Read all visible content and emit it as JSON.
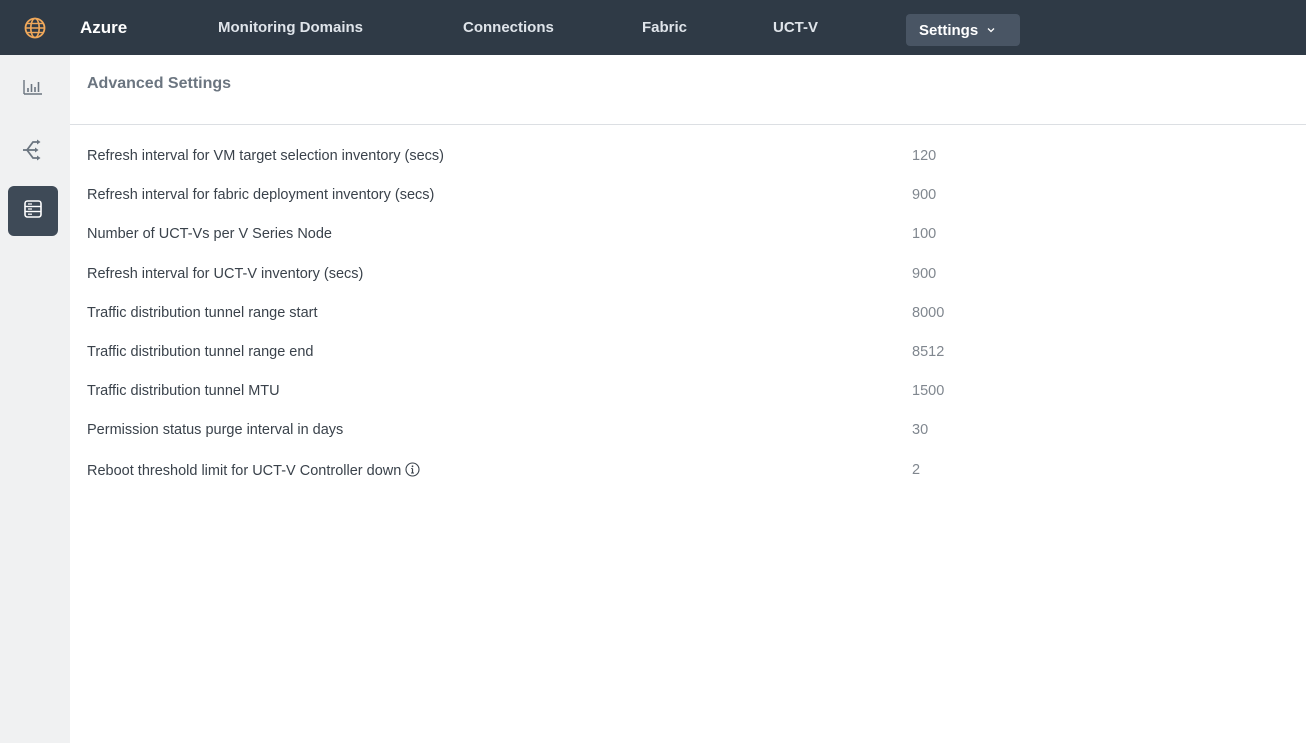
{
  "app": {
    "brand": "Azure",
    "brand_icon": "globe-icon"
  },
  "nav": {
    "items": [
      {
        "label": "Monitoring Domains"
      },
      {
        "label": "Connections"
      },
      {
        "label": "Fabric"
      },
      {
        "label": "UCT-V"
      }
    ],
    "settings_label": "Settings",
    "settings_icon": "chevron-down-icon"
  },
  "sidebar": {
    "items": [
      {
        "icon": "bar-chart-icon",
        "active": false
      },
      {
        "icon": "network-icon",
        "active": false
      },
      {
        "icon": "server-icon",
        "active": true
      }
    ]
  },
  "page": {
    "title": "Advanced Settings"
  },
  "settings": [
    {
      "label": "Refresh interval for VM target selection inventory (secs)",
      "value": "120"
    },
    {
      "label": "Refresh interval for fabric deployment inventory (secs)",
      "value": "900"
    },
    {
      "label": "Number of UCT-Vs per V Series Node",
      "value": "100"
    },
    {
      "label": "Refresh interval for UCT-V inventory (secs)",
      "value": "900"
    },
    {
      "label": "Traffic distribution tunnel range start",
      "value": "8000"
    },
    {
      "label": "Traffic distribution tunnel range end",
      "value": "8512"
    },
    {
      "label": "Traffic distribution tunnel MTU",
      "value": "1500"
    },
    {
      "label": "Permission status purge interval in days",
      "value": "30"
    },
    {
      "label": "Reboot threshold limit for UCT-V Controller down",
      "value": "2",
      "info_icon": "info-icon"
    }
  ],
  "colors": {
    "topbar": "#2f3a46",
    "accent_icon": "#f0a85a",
    "sidebar": "#f0f1f2",
    "active_side": "#3e4a57"
  }
}
